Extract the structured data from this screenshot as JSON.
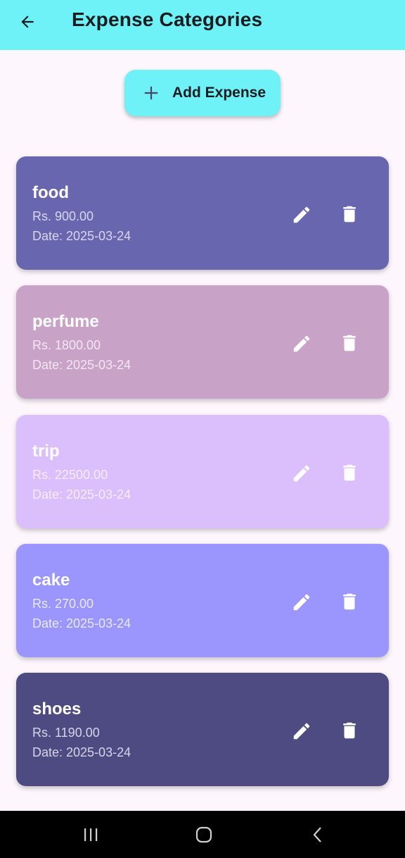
{
  "app_bar": {
    "title": "Expense Categories",
    "back_icon": "arrow-left-icon",
    "color": "#6ef2f8"
  },
  "add_button": {
    "label": "Add Expense",
    "icon": "plus-icon"
  },
  "expenses": [
    {
      "name": "food",
      "amount": "Rs. 900.00",
      "date": "Date: 2025-03-24",
      "color": "#6966b0",
      "text_color": "#ffffff",
      "sub_color": "#d8d6f0"
    },
    {
      "name": "perfume",
      "amount": "Rs. 1800.00",
      "date": "Date: 2025-03-24",
      "color": "#c9a2c8",
      "text_color": "#ffffff",
      "sub_color": "#f3e6f3"
    },
    {
      "name": "trip",
      "amount": "Rs. 22500.00",
      "date": "Date: 2025-03-24",
      "color": "#dbbffc",
      "text_color": "#ffffff",
      "sub_color": "#f5ecff"
    },
    {
      "name": "cake",
      "amount": "Rs. 270.00",
      "date": "Date: 2025-03-24",
      "color": "#9a96fe",
      "text_color": "#ffffff",
      "sub_color": "#e9e8ff"
    },
    {
      "name": "shoes",
      "amount": "Rs. 1190.00",
      "date": "Date: 2025-03-24",
      "color": "#4d4b82",
      "text_color": "#ffffff",
      "sub_color": "#d6d5ea"
    }
  ],
  "card_icons": {
    "edit": "pencil-icon",
    "delete": "trash-icon"
  },
  "system_nav": {
    "recents": "recents-icon",
    "home": "home-icon",
    "back": "chevron-left-icon"
  }
}
